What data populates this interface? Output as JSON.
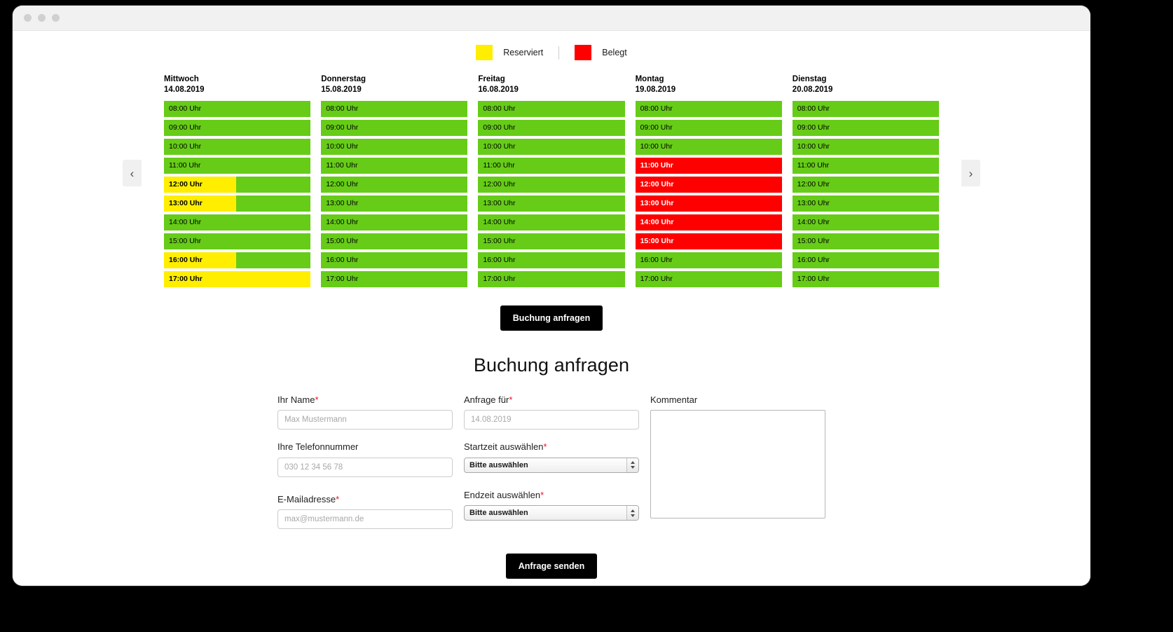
{
  "window": {
    "dots": [
      "dot-1",
      "dot-2",
      "dot-3"
    ]
  },
  "legend": {
    "reserviert_label": "Reserviert",
    "belegt_label": "Belegt",
    "reserviert_color": "#ffee00",
    "belegt_color": "#ff0000",
    "frei_color": "#66cc18"
  },
  "nav": {
    "prev_icon": "chevron-left-icon",
    "next_icon": "chevron-right-icon",
    "prev_glyph": "‹",
    "next_glyph": "›"
  },
  "calendar": {
    "days": [
      {
        "name": "Mittwoch",
        "date": "14.08.2019",
        "slots": [
          {
            "time": "08:00 Uhr",
            "state": "frei",
            "fill": 0
          },
          {
            "time": "09:00 Uhr",
            "state": "frei",
            "fill": 0
          },
          {
            "time": "10:00 Uhr",
            "state": "frei",
            "fill": 0
          },
          {
            "time": "11:00 Uhr",
            "state": "frei",
            "fill": 0
          },
          {
            "time": "12:00 Uhr",
            "state": "teilweise-reserviert",
            "fill": 49
          },
          {
            "time": "13:00 Uhr",
            "state": "teilweise-reserviert",
            "fill": 49
          },
          {
            "time": "14:00 Uhr",
            "state": "frei",
            "fill": 0
          },
          {
            "time": "15:00 Uhr",
            "state": "frei",
            "fill": 0
          },
          {
            "time": "16:00 Uhr",
            "state": "teilweise-reserviert",
            "fill": 49
          },
          {
            "time": "17:00 Uhr",
            "state": "reserviert",
            "fill": 100
          }
        ]
      },
      {
        "name": "Donnerstag",
        "date": "15.08.2019",
        "slots": [
          {
            "time": "08:00 Uhr",
            "state": "frei",
            "fill": 0
          },
          {
            "time": "09:00 Uhr",
            "state": "frei",
            "fill": 0
          },
          {
            "time": "10:00 Uhr",
            "state": "frei",
            "fill": 0
          },
          {
            "time": "11:00 Uhr",
            "state": "frei",
            "fill": 0
          },
          {
            "time": "12:00 Uhr",
            "state": "frei",
            "fill": 0
          },
          {
            "time": "13:00 Uhr",
            "state": "frei",
            "fill": 0
          },
          {
            "time": "14:00 Uhr",
            "state": "frei",
            "fill": 0
          },
          {
            "time": "15:00 Uhr",
            "state": "frei",
            "fill": 0
          },
          {
            "time": "16:00 Uhr",
            "state": "frei",
            "fill": 0
          },
          {
            "time": "17:00 Uhr",
            "state": "frei",
            "fill": 0
          }
        ]
      },
      {
        "name": "Freitag",
        "date": "16.08.2019",
        "slots": [
          {
            "time": "08:00 Uhr",
            "state": "frei",
            "fill": 0
          },
          {
            "time": "09:00 Uhr",
            "state": "frei",
            "fill": 0
          },
          {
            "time": "10:00 Uhr",
            "state": "frei",
            "fill": 0
          },
          {
            "time": "11:00 Uhr",
            "state": "frei",
            "fill": 0
          },
          {
            "time": "12:00 Uhr",
            "state": "frei",
            "fill": 0
          },
          {
            "time": "13:00 Uhr",
            "state": "frei",
            "fill": 0
          },
          {
            "time": "14:00 Uhr",
            "state": "frei",
            "fill": 0
          },
          {
            "time": "15:00 Uhr",
            "state": "frei",
            "fill": 0
          },
          {
            "time": "16:00 Uhr",
            "state": "frei",
            "fill": 0
          },
          {
            "time": "17:00 Uhr",
            "state": "frei",
            "fill": 0
          }
        ]
      },
      {
        "name": "Montag",
        "date": "19.08.2019",
        "slots": [
          {
            "time": "08:00 Uhr",
            "state": "frei",
            "fill": 0
          },
          {
            "time": "09:00 Uhr",
            "state": "frei",
            "fill": 0
          },
          {
            "time": "10:00 Uhr",
            "state": "frei",
            "fill": 0
          },
          {
            "time": "11:00 Uhr",
            "state": "belegt",
            "fill": 100
          },
          {
            "time": "12:00 Uhr",
            "state": "belegt",
            "fill": 100
          },
          {
            "time": "13:00 Uhr",
            "state": "belegt",
            "fill": 100
          },
          {
            "time": "14:00 Uhr",
            "state": "belegt",
            "fill": 100
          },
          {
            "time": "15:00 Uhr",
            "state": "belegt",
            "fill": 100
          },
          {
            "time": "16:00 Uhr",
            "state": "frei",
            "fill": 0
          },
          {
            "time": "17:00 Uhr",
            "state": "frei",
            "fill": 0
          }
        ]
      },
      {
        "name": "Dienstag",
        "date": "20.08.2019",
        "slots": [
          {
            "time": "08:00 Uhr",
            "state": "frei",
            "fill": 0
          },
          {
            "time": "09:00 Uhr",
            "state": "frei",
            "fill": 0
          },
          {
            "time": "10:00 Uhr",
            "state": "frei",
            "fill": 0
          },
          {
            "time": "11:00 Uhr",
            "state": "frei",
            "fill": 0
          },
          {
            "time": "12:00 Uhr",
            "state": "frei",
            "fill": 0
          },
          {
            "time": "13:00 Uhr",
            "state": "frei",
            "fill": 0
          },
          {
            "time": "14:00 Uhr",
            "state": "frei",
            "fill": 0
          },
          {
            "time": "15:00 Uhr",
            "state": "frei",
            "fill": 0
          },
          {
            "time": "16:00 Uhr",
            "state": "frei",
            "fill": 0
          },
          {
            "time": "17:00 Uhr",
            "state": "frei",
            "fill": 0
          }
        ]
      }
    ]
  },
  "request_button": {
    "label": "Buchung anfragen"
  },
  "form": {
    "title": "Buchung anfragen",
    "name": {
      "label": "Ihr Name",
      "required": "*",
      "placeholder": "Max Mustermann",
      "value": ""
    },
    "phone": {
      "label": "Ihre Telefonnummer",
      "required": "",
      "placeholder": "030 12 34 56 78",
      "value": ""
    },
    "email": {
      "label": "E-Mailadresse",
      "required": "*",
      "placeholder": "max@mustermann.de",
      "value": ""
    },
    "request_for": {
      "label": "Anfrage für",
      "required": "*",
      "placeholder": "14.08.2019",
      "value": ""
    },
    "start_time": {
      "label": "Startzeit auswählen",
      "required": "*",
      "selected": "Bitte auswählen"
    },
    "end_time": {
      "label": "Endzeit auswählen",
      "required": "*",
      "selected": "Bitte auswählen"
    },
    "comment": {
      "label": "Kommentar",
      "required": "",
      "placeholder": "",
      "value": ""
    },
    "submit": {
      "label": "Anfrage senden"
    }
  }
}
